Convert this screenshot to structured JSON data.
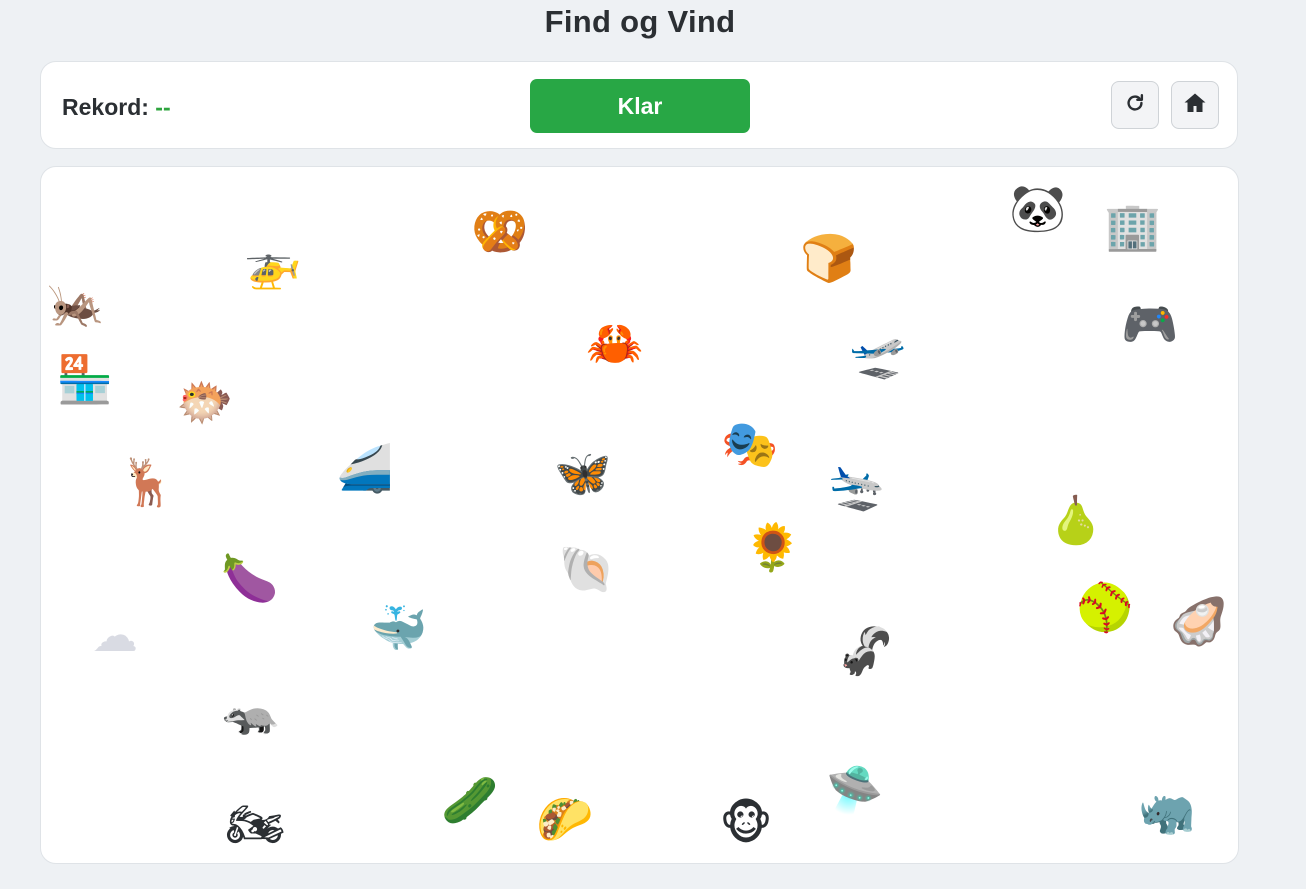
{
  "title": "Find og Vind",
  "toolbar": {
    "record_label": "Rekord:",
    "record_value": "--",
    "ready_label": "Klar",
    "refresh_icon": "refresh-icon",
    "home_icon": "home-icon"
  },
  "colors": {
    "accent": "#28a745",
    "record_value": "#2ea43e",
    "background": "#eef1f4"
  },
  "board": {
    "items": [
      {
        "name": "grasshopper",
        "glyph": "🦗"
      },
      {
        "name": "helicopter",
        "glyph": "🚁"
      },
      {
        "name": "pretzel",
        "glyph": "🥨"
      },
      {
        "name": "bread",
        "glyph": "🍞"
      },
      {
        "name": "panda",
        "glyph": "🐼"
      },
      {
        "name": "office-building",
        "glyph": "🏢"
      },
      {
        "name": "crab",
        "glyph": "🦀"
      },
      {
        "name": "airplane-departure",
        "glyph": "🛫"
      },
      {
        "name": "video-game",
        "glyph": "🎮"
      },
      {
        "name": "convenience-store",
        "glyph": "🏪"
      },
      {
        "name": "blowfish",
        "glyph": "🐡"
      },
      {
        "name": "deer",
        "glyph": "🦌"
      },
      {
        "name": "high-speed-train",
        "glyph": "🚄"
      },
      {
        "name": "butterfly",
        "glyph": "🦋"
      },
      {
        "name": "performing-arts",
        "glyph": "🎭"
      },
      {
        "name": "airplane-arrival",
        "glyph": "🛬"
      },
      {
        "name": "pear",
        "glyph": "🍐"
      },
      {
        "name": "eggplant",
        "glyph": "🍆"
      },
      {
        "name": "spiral-shell",
        "glyph": "🐚"
      },
      {
        "name": "sunflower",
        "glyph": "🌻"
      },
      {
        "name": "cloud",
        "glyph": "☁"
      },
      {
        "name": "spouting-whale",
        "glyph": "🐳"
      },
      {
        "name": "softball",
        "glyph": "🥎"
      },
      {
        "name": "oyster",
        "glyph": "🦪"
      },
      {
        "name": "skunk",
        "glyph": "🦨"
      },
      {
        "name": "badger",
        "glyph": "🦡"
      },
      {
        "name": "cucumber",
        "glyph": "🥒"
      },
      {
        "name": "flying-saucer",
        "glyph": "🛸"
      },
      {
        "name": "motorcycle",
        "glyph": "🏍"
      },
      {
        "name": "taco",
        "glyph": "🌮"
      },
      {
        "name": "monkey-face",
        "glyph": "🐵"
      },
      {
        "name": "rhinoceros",
        "glyph": "🦏"
      }
    ]
  }
}
